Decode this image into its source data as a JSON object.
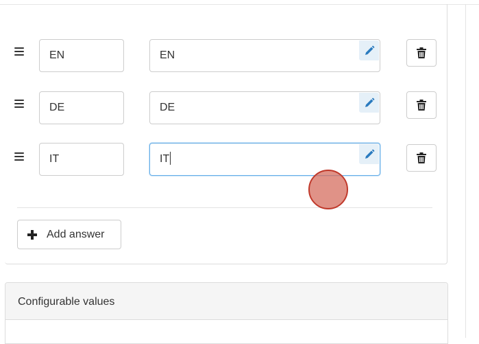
{
  "answers": [
    {
      "code": "EN",
      "label": "EN"
    },
    {
      "code": "DE",
      "label": "DE"
    },
    {
      "code": "IT",
      "label": "IT"
    }
  ],
  "add_answer_label": "Add answer",
  "configurable_values_title": "Configurable values",
  "colors": {
    "focus_border": "#66afe9",
    "edit_icon": "#2b7bbf",
    "click_indicator": "#d66e5f"
  },
  "icons": {
    "drag": "drag-handle-icon",
    "edit": "pencil-icon",
    "delete": "trash-icon",
    "add": "plus-icon"
  }
}
